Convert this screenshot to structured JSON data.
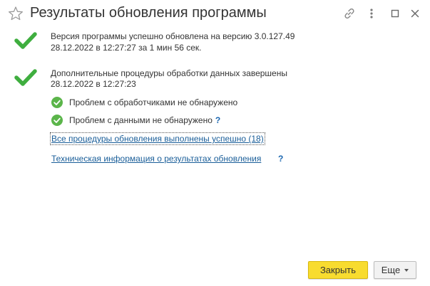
{
  "window": {
    "title": "Результаты обновления программы"
  },
  "titlebar_icons": [
    "star-icon",
    "link-icon",
    "more-vertical-icon",
    "maximize-icon",
    "close-icon"
  ],
  "messages": {
    "version_line1": "Версия программы успешно обновлена на версию 3.0.127.49",
    "version_line2": "28.12.2022 в 12:27:27 за 1 мин 56 сек.",
    "procedures_line1": "Дополнительные процедуры обработки данных завершены",
    "procedures_line2": "28.12.2022 в 12:27:23"
  },
  "checks": {
    "handlers": "Проблем с обработчиками не обнаружено",
    "data": "Проблем с данными не обнаружено",
    "help_mark": "?"
  },
  "links": {
    "all_procedures": "Все процедуры обновления выполнены успешно (18)",
    "tech_info": "Техническая информация о результатах обновления",
    "help_mark": "?"
  },
  "buttons": {
    "close": "Закрыть",
    "more": "Еще"
  },
  "colors": {
    "check_green": "#3fae3f",
    "link_blue": "#1a5e99",
    "primary_button": "#f8dc2f"
  }
}
